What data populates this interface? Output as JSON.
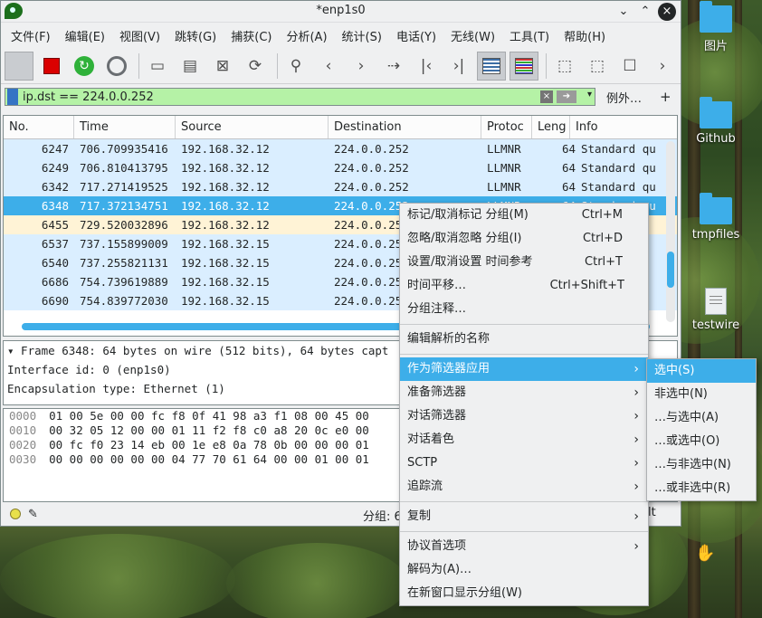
{
  "window": {
    "title": "*enp1s0"
  },
  "menubar": [
    "文件(F)",
    "编辑(E)",
    "视图(V)",
    "跳转(G)",
    "捕获(C)",
    "分析(A)",
    "统计(S)",
    "电话(Y)",
    "无线(W)",
    "工具(T)",
    "帮助(H)"
  ],
  "filter": {
    "value": "ip.dst == 224.0.0.252",
    "extra": "例外…",
    "plus": "+"
  },
  "packet_list": {
    "columns": [
      "No.",
      "Time",
      "Source",
      "Destination",
      "Protoc",
      "Leng",
      "Info"
    ],
    "rows": [
      {
        "no": "6247",
        "time": "706.709935416",
        "src": "192.168.32.12",
        "dst": "224.0.0.252",
        "proto": "LLMNR",
        "len": "64",
        "info": "Standard qu",
        "style": "llmnr"
      },
      {
        "no": "6249",
        "time": "706.810413795",
        "src": "192.168.32.12",
        "dst": "224.0.0.252",
        "proto": "LLMNR",
        "len": "64",
        "info": "Standard qu",
        "style": "llmnr"
      },
      {
        "no": "6342",
        "time": "717.271419525",
        "src": "192.168.32.12",
        "dst": "224.0.0.252",
        "proto": "LLMNR",
        "len": "64",
        "info": "Standard qu",
        "style": "llmnr"
      },
      {
        "no": "6348",
        "time": "717.372134751",
        "src": "192.168.32.12",
        "dst": "224.0.0.252",
        "proto": "LLMNR",
        "len": "64",
        "info": "Standard qu",
        "style": "sel"
      },
      {
        "no": "6455",
        "time": "729.520032896",
        "src": "192.168.32.12",
        "dst": "224.0.0.25",
        "proto": "",
        "len": "",
        "info": "",
        "style": "alt"
      },
      {
        "no": "6537",
        "time": "737.155899009",
        "src": "192.168.32.15",
        "dst": "224.0.0.25",
        "proto": "",
        "len": "",
        "info": "",
        "style": "llmnr"
      },
      {
        "no": "6540",
        "time": "737.255821131",
        "src": "192.168.32.15",
        "dst": "224.0.0.25",
        "proto": "",
        "len": "",
        "info": "",
        "style": "llmnr"
      },
      {
        "no": "6686",
        "time": "754.739619889",
        "src": "192.168.32.15",
        "dst": "224.0.0.25",
        "proto": "",
        "len": "",
        "info": "",
        "style": "llmnr"
      },
      {
        "no": "6690",
        "time": "754.839772030",
        "src": "192.168.32.15",
        "dst": "224.0.0.25",
        "proto": "",
        "len": "",
        "info": "",
        "style": "llmnr"
      }
    ]
  },
  "details": [
    "▾ Frame 6348: 64 bytes on wire (512 bits), 64 bytes capt",
    "    Interface id: 0 (enp1s0)",
    "    Encapsulation type: Ethernet (1)"
  ],
  "bytes": [
    {
      "off": "0000",
      "hex": "01 00 5e 00 00 fc f8 0f  41 98 a3 f1 08 00 45 00"
    },
    {
      "off": "0010",
      "hex": "00 32 05 12 00 00 01 11  f2 f8 c0 a8 20 0c e0 00"
    },
    {
      "off": "0020",
      "hex": "00 fc f0 23 14 eb 00 1e  e8 0a 78 0b 00 00 00 01"
    },
    {
      "off": "0030",
      "hex": "00 00 00 00 00 00 04 77  70 61 64 00 00 01 00 01"
    }
  ],
  "status": {
    "text": "分组: 6",
    "tail": "lt"
  },
  "context_menu": {
    "items": [
      {
        "label": "标记/取消标记 分组(M)",
        "shortcut": "Ctrl+M"
      },
      {
        "label": "忽略/取消忽略 分组(I)",
        "shortcut": "Ctrl+D"
      },
      {
        "label": "设置/取消设置 时间参考",
        "shortcut": "Ctrl+T"
      },
      {
        "label": "时间平移…",
        "shortcut": "Ctrl+Shift+T"
      },
      {
        "label": "分组注释…",
        "shortcut": ""
      },
      {
        "label": "编辑解析的名称",
        "shortcut": ""
      },
      {
        "label": "作为筛选器应用",
        "submenu": true
      },
      {
        "label": "准备筛选器",
        "submenu": true
      },
      {
        "label": "对话筛选器",
        "submenu": true
      },
      {
        "label": "对话着色",
        "submenu": true
      },
      {
        "label": "SCTP",
        "submenu": true
      },
      {
        "label": "追踪流",
        "submenu": true
      },
      {
        "label": "复制",
        "submenu": true
      },
      {
        "label": "协议首选项",
        "submenu": true
      },
      {
        "label": "解码为(A)…",
        "shortcut": ""
      },
      {
        "label": "在新窗口显示分组(W)",
        "shortcut": ""
      }
    ],
    "submenu": [
      "选中(S)",
      "非选中(N)",
      "…与选中(A)",
      "…或选中(O)",
      "…与非选中(N)",
      "…或非选中(R)"
    ]
  },
  "desktop_icons": [
    "图片",
    "Github",
    "tmpfiles",
    "testwire"
  ],
  "colors": {
    "accent": "#3daee9",
    "filter_ok": "#b5f2a6",
    "llmnr_row": "#daeeff",
    "selected_row": "#3daee9"
  }
}
